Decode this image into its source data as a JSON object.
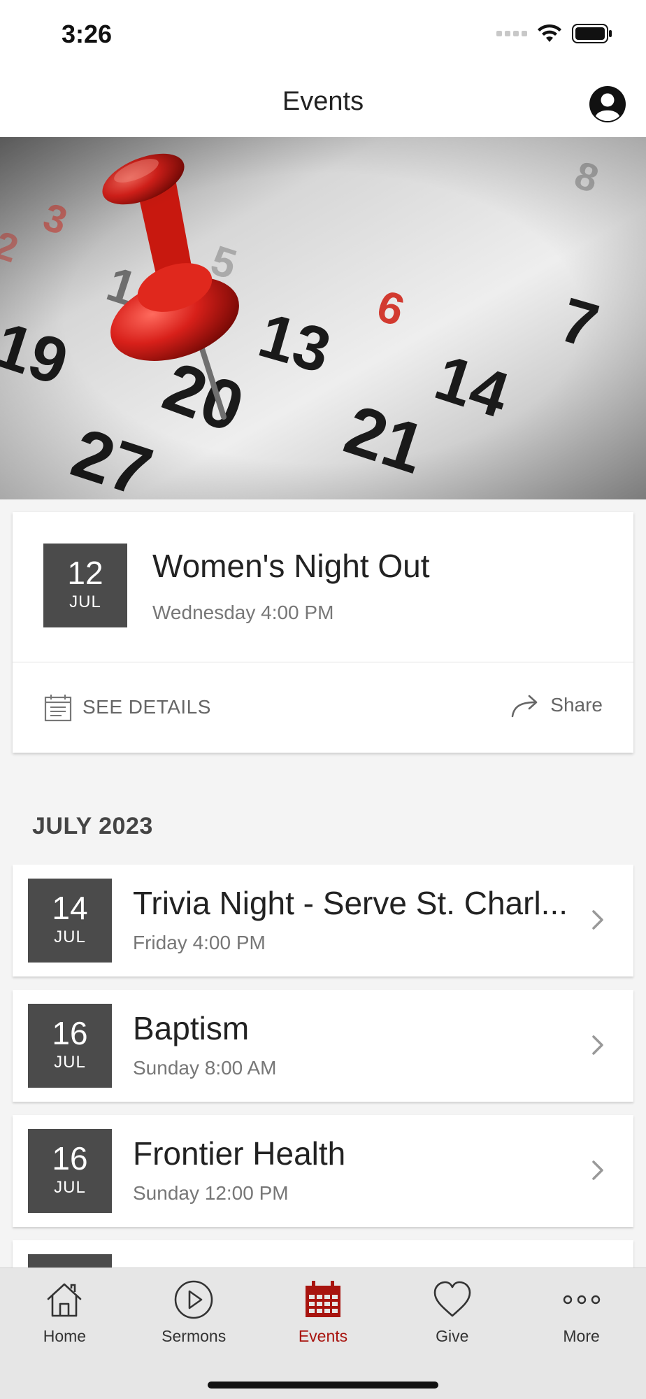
{
  "status_bar": {
    "time": "3:26"
  },
  "header": {
    "title": "Events"
  },
  "featured": {
    "day": "12",
    "month": "JUL",
    "title": "Women's Night Out",
    "subtitle": "Wednesday 4:00 PM",
    "details_label": "SEE DETAILS",
    "share_label": "Share"
  },
  "section": {
    "heading": "JULY 2023"
  },
  "events": [
    {
      "day": "14",
      "month": "JUL",
      "title": "Trivia Night - Serve St. Charl...",
      "subtitle": "Friday 4:00 PM"
    },
    {
      "day": "16",
      "month": "JUL",
      "title": "Baptism",
      "subtitle": "Sunday 8:00 AM"
    },
    {
      "day": "16",
      "month": "JUL",
      "title": "Frontier Health",
      "subtitle": "Sunday 12:00 PM"
    }
  ],
  "tabs": [
    {
      "label": "Home",
      "icon": "house-icon"
    },
    {
      "label": "Sermons",
      "icon": "play-circle-icon"
    },
    {
      "label": "Events",
      "icon": "calendar-icon",
      "active": true
    },
    {
      "label": "Give",
      "icon": "heart-icon"
    },
    {
      "label": "More",
      "icon": "ellipsis-icon"
    }
  ],
  "colors": {
    "accent": "#a8140f",
    "date_box": "#4b4b4b",
    "pin": "#d8201a"
  }
}
